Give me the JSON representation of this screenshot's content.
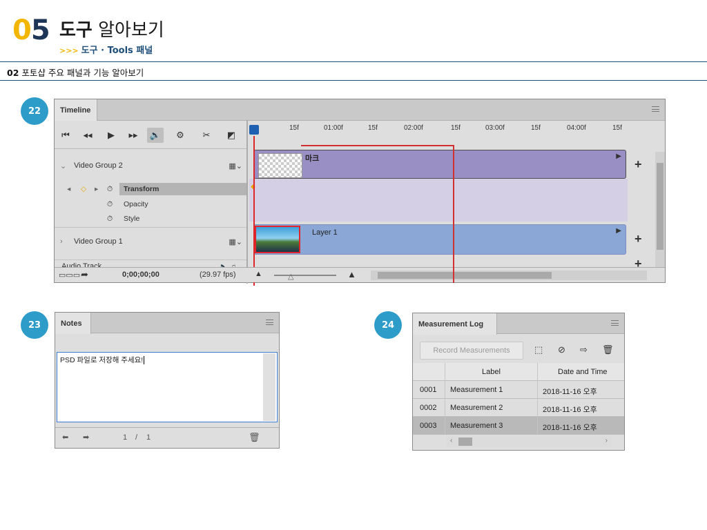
{
  "header": {
    "chapter_num_first": "0",
    "chapter_num_second": "5",
    "title_bold": "도구",
    "title_rest": "알아보기",
    "subtitle_arrows": ">>>",
    "subtitle": "도구 · Tools 패널",
    "section_num": "02",
    "section_title": "포토샵 주요 패널과 기능 알아보기"
  },
  "badges": {
    "timeline": "22",
    "notes": "23",
    "measurement": "24"
  },
  "timeline": {
    "tab": "Timeline",
    "ruler": [
      "15f",
      "01:00f",
      "15f",
      "02:00f",
      "15f",
      "03:00f",
      "15f",
      "04:00f",
      "15f"
    ],
    "groups": {
      "video_group_2": "Video Group 2",
      "transform": "Transform",
      "opacity": "Opacity",
      "style": "Style",
      "video_group_1": "Video Group 1",
      "audio_track": "Audio Track"
    },
    "clips": {
      "clip_2": "마크",
      "clip_1": "Layer 1"
    },
    "timecode": "0;00;00;00",
    "fps": "(29.97 fps)"
  },
  "notes": {
    "tab": "Notes",
    "text": "PSD 파일로 저장해 주세요!",
    "page_current": "1",
    "page_sep": "/",
    "page_total": "1"
  },
  "measurement": {
    "tab": "Measurement Log",
    "record_button": "Record Measurements",
    "columns": [
      "Label",
      "Date and Time"
    ],
    "rows": [
      {
        "id": "0001",
        "label": "Measurement 1",
        "date": "2018-11-16 오후"
      },
      {
        "id": "0002",
        "label": "Measurement 2",
        "date": "2018-11-16 오후"
      },
      {
        "id": "0003",
        "label": "Measurement 3",
        "date": "2018-11-16 오후"
      }
    ]
  }
}
